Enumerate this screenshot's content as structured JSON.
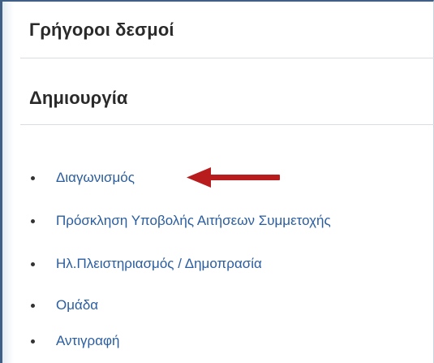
{
  "quick_links": {
    "title": "Γρήγοροι δεσμοί"
  },
  "create": {
    "title": "Δημιουργία",
    "items": [
      {
        "label": "Διαγωνισμός"
      },
      {
        "label": "Πρόσκληση Υποβολής Αιτήσεων Συμμετοχής"
      },
      {
        "label": "Ηλ.Πλειστηριασμός / Δημοπρασία"
      },
      {
        "label": "Ομάδα"
      },
      {
        "label": "Αντιγραφή"
      }
    ]
  },
  "annotation": {
    "icon": "left-arrow-icon",
    "color": "#b81c1c"
  }
}
